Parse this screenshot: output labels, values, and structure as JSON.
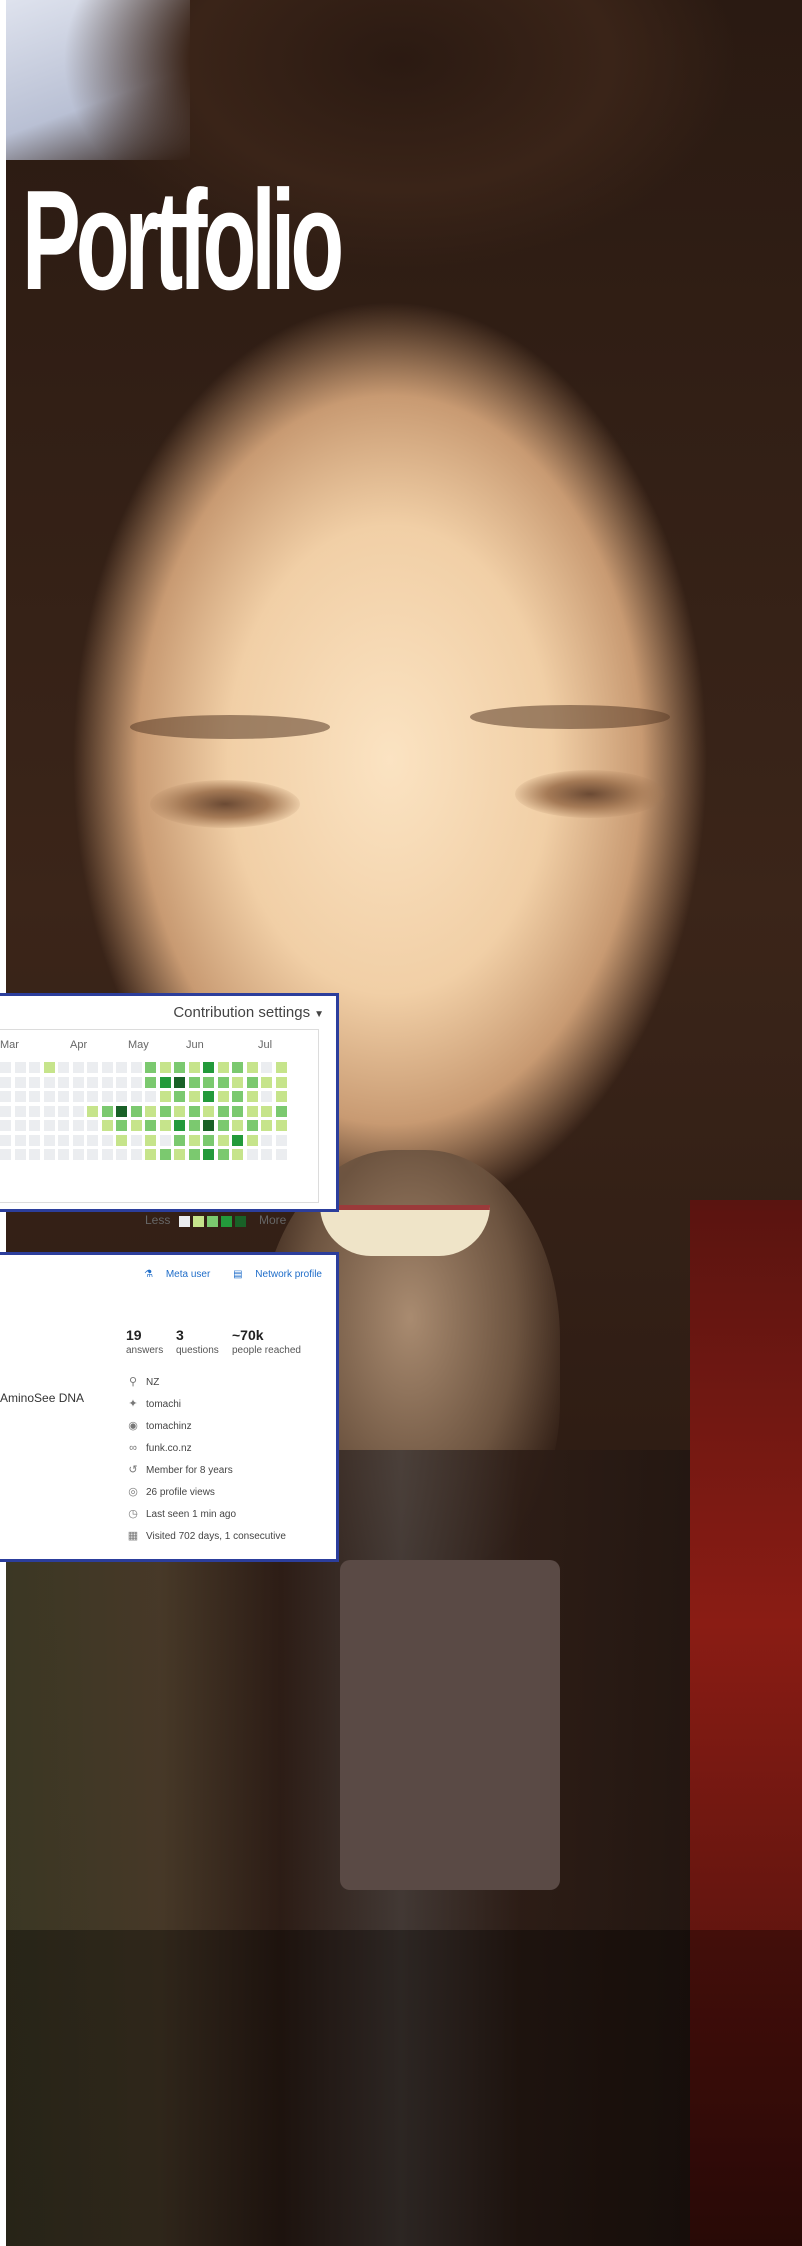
{
  "page": {
    "title": "Portfolio"
  },
  "contributions": {
    "settings_label": "Contribution settings",
    "months": [
      "Mar",
      "Apr",
      "May",
      "Jun",
      "Jul"
    ],
    "legend_less": "Less",
    "legend_more": "More",
    "levels": [
      "#ebedf0",
      "#c6e48b",
      "#7bc96f",
      "#239a3b",
      "#196127"
    ],
    "weeks": [
      [
        0,
        0,
        0,
        0,
        0,
        0,
        0
      ],
      [
        0,
        0,
        0,
        0,
        0,
        0,
        0
      ],
      [
        0,
        0,
        0,
        0,
        0,
        0,
        0
      ],
      [
        1,
        0,
        0,
        0,
        0,
        0,
        0
      ],
      [
        0,
        0,
        0,
        0,
        0,
        0,
        0
      ],
      [
        0,
        0,
        0,
        0,
        0,
        0,
        0
      ],
      [
        0,
        0,
        0,
        1,
        0,
        0,
        0
      ],
      [
        0,
        0,
        0,
        2,
        1,
        0,
        0
      ],
      [
        0,
        0,
        0,
        4,
        2,
        1,
        0
      ],
      [
        0,
        0,
        0,
        2,
        1,
        0,
        0
      ],
      [
        2,
        2,
        0,
        1,
        2,
        1,
        1
      ],
      [
        1,
        3,
        1,
        2,
        1,
        0,
        2
      ],
      [
        2,
        4,
        2,
        1,
        3,
        2,
        1
      ],
      [
        1,
        2,
        1,
        2,
        2,
        1,
        2
      ],
      [
        3,
        2,
        3,
        1,
        4,
        2,
        3
      ],
      [
        1,
        2,
        1,
        2,
        2,
        1,
        2
      ],
      [
        2,
        1,
        2,
        2,
        1,
        3,
        1
      ],
      [
        1,
        2,
        1,
        1,
        2,
        1,
        0
      ],
      [
        0,
        1,
        0,
        1,
        1,
        0,
        0
      ],
      [
        1,
        1,
        1,
        2,
        1,
        0,
        0
      ]
    ]
  },
  "profile": {
    "links": {
      "meta": "Meta user",
      "network": "Network profile"
    },
    "stats": [
      {
        "value": "19",
        "label": "answers"
      },
      {
        "value": "3",
        "label": "questions"
      },
      {
        "value": "~70k",
        "label": "people reached"
      }
    ],
    "left_fragment": "AminoSee DNA",
    "details": [
      {
        "icon": "location-icon",
        "glyph": "⚲",
        "text": "NZ"
      },
      {
        "icon": "twitter-icon",
        "glyph": "✦",
        "text": "tomachi"
      },
      {
        "icon": "github-icon",
        "glyph": "◉",
        "text": "tomachinz"
      },
      {
        "icon": "link-icon",
        "glyph": "∞",
        "text": "funk.co.nz"
      },
      {
        "icon": "history-icon",
        "glyph": "↺",
        "text": "Member for 8 years"
      },
      {
        "icon": "eye-icon",
        "glyph": "◎",
        "text": "26 profile views"
      },
      {
        "icon": "clock-icon",
        "glyph": "◷",
        "text": "Last seen 1 min ago"
      },
      {
        "icon": "calendar-icon",
        "glyph": "▦",
        "text": "Visited 702 days, 1 consecutive"
      }
    ]
  }
}
